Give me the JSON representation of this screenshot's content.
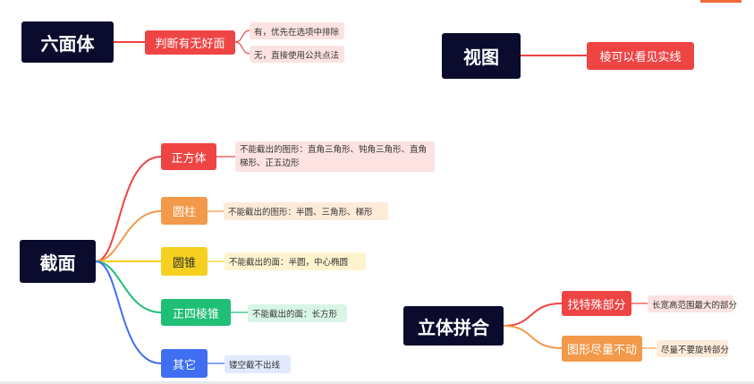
{
  "hexahedron": {
    "root": "六面体",
    "branch": "判断有无好面",
    "leaves": [
      "有，优先在选项中排除",
      "无，直接使用公共点法"
    ]
  },
  "view": {
    "root": "视图",
    "branch": "棱可以看见实线"
  },
  "section": {
    "root": "截面",
    "branches": [
      {
        "label": "正方体",
        "leaf": "不能截出的图形：直角三角形、钝角三角形、直角梯形、正五边形"
      },
      {
        "label": "圆柱",
        "leaf": "不能截出的图形：半圆、三角形、梯形"
      },
      {
        "label": "圆锥",
        "leaf": "不能截出的面：半圆，中心椭圆"
      },
      {
        "label": "正四棱锥",
        "leaf": "不能截出的面：长方形"
      },
      {
        "label": "其它",
        "leaf": "镂空截不出线"
      }
    ]
  },
  "assembly": {
    "root": "立体拼合",
    "branches": [
      {
        "label": "找特殊部分",
        "leaf": "长宽高范围最大的部分"
      },
      {
        "label": "图形尽量不动",
        "leaf": "尽量不要旋转部分"
      }
    ]
  },
  "colors": {
    "red": "#ef4444",
    "orange": "#f2994a",
    "yellow": "#f5d020",
    "green": "#1fbf75",
    "blue": "#3f6ef2",
    "root": "#0b0b2e"
  }
}
